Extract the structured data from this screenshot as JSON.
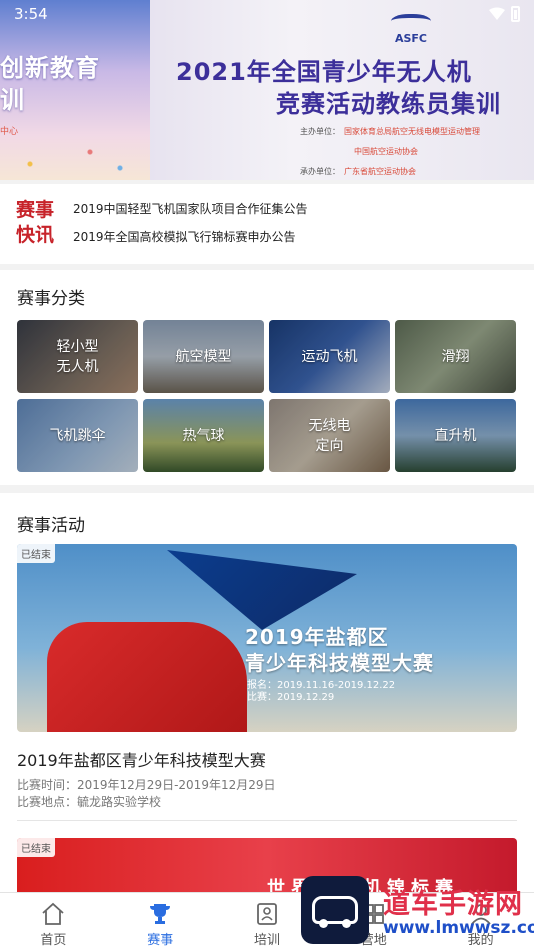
{
  "status_bar": {
    "time": "3:54"
  },
  "banner": {
    "left_line1": "创新教育",
    "left_line2": "训",
    "left_sub": "中心",
    "logo_text": "ASFC",
    "title_line1": "2021年全国青少年无人机",
    "title_line2": "竞赛活动教练员集训",
    "organizers": [
      {
        "label": "主办单位：",
        "value": "国家体育总局航空无线电模型运动管理"
      },
      {
        "label": "",
        "value": "中国航空运动协会"
      },
      {
        "label": "承办单位：",
        "value": "广东省航空运动协会"
      }
    ]
  },
  "news": {
    "logo_line1": "赛事",
    "logo_line2": "快讯",
    "items": [
      "2019中国轻型飞机国家队项目合作征集公告",
      "2019年全国高校模拟飞行锦标赛申办公告"
    ]
  },
  "categories": {
    "title": "赛事分类",
    "items": [
      {
        "line1": "轻小型",
        "line2": "无人机"
      },
      {
        "line1": "航空模型",
        "line2": ""
      },
      {
        "line1": "运动飞机",
        "line2": ""
      },
      {
        "line1": "滑翔",
        "line2": ""
      },
      {
        "line1": "飞机跳伞",
        "line2": ""
      },
      {
        "line1": "热气球",
        "line2": ""
      },
      {
        "line1": "无线电",
        "line2": "定向"
      },
      {
        "line1": "直升机",
        "line2": ""
      }
    ]
  },
  "activities": {
    "title": "赛事活动",
    "items": [
      {
        "badge": "已结束",
        "poster_line1": "2019年盐都区",
        "poster_line2": "青少年科技模型大赛",
        "poster_signup": "报名：2019.11.16-2019.12.22",
        "poster_match": "比赛：2019.12.29",
        "name": "2019年盐都区青少年科技模型大赛",
        "time": "比赛时间：2019年12月29日-2019年12月29日",
        "place": "比赛地点：毓龙路实验学校"
      },
      {
        "badge": "已结束",
        "poster_text": "世界……机锦标赛"
      }
    ]
  },
  "tabbar": {
    "tabs": [
      {
        "label": "首页",
        "icon": "home-icon"
      },
      {
        "label": "赛事",
        "icon": "trophy-icon"
      },
      {
        "label": "培训",
        "icon": "training-icon"
      },
      {
        "label": "营地",
        "icon": "camp-icon"
      },
      {
        "label": "我的",
        "icon": "profile-icon"
      }
    ],
    "active_color": "#2a6de0"
  },
  "watermark": {
    "text": "道车手游网",
    "url": "www.lmwwsz.com"
  }
}
